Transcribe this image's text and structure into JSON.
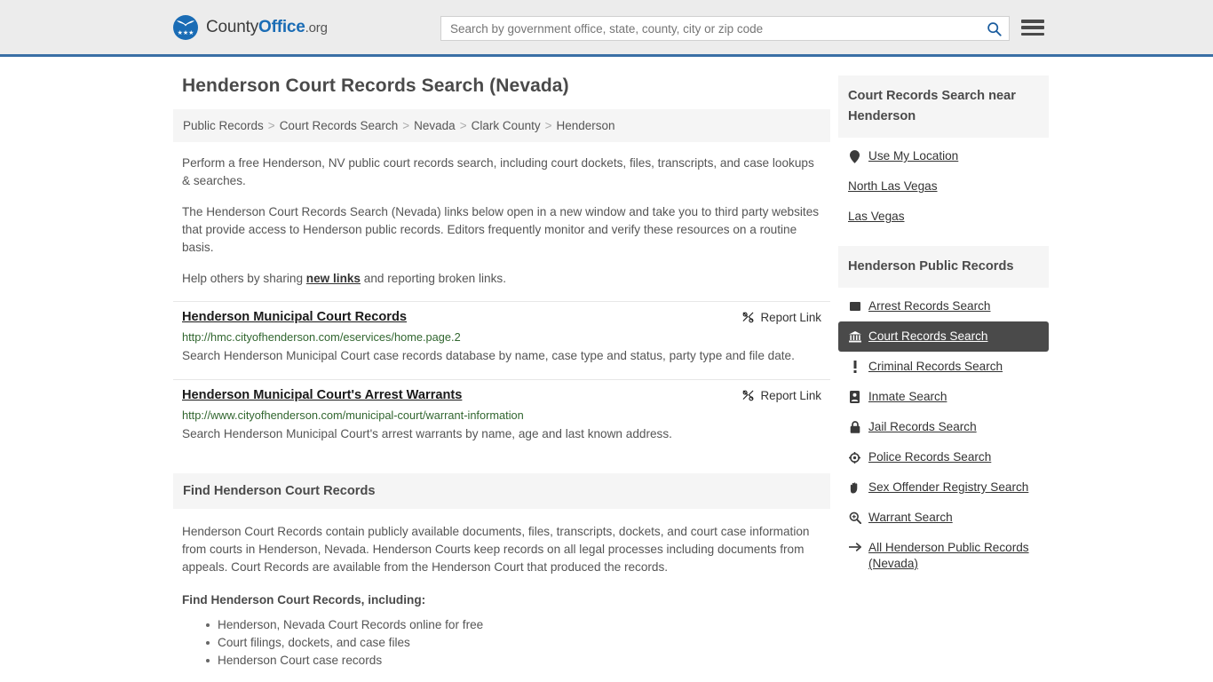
{
  "header": {
    "brand": {
      "part1": "County",
      "part2": "Office",
      "part3": ".org",
      "logo_icon": "eagle-shield-icon"
    },
    "search": {
      "placeholder": "Search by government office, state, county, city or zip code",
      "value": "",
      "icon": "search-icon"
    },
    "menu_icon": "hamburger-menu-icon",
    "accent_color": "#3a6fa5"
  },
  "main": {
    "page_title": "Henderson Court Records Search (Nevada)",
    "breadcrumb": [
      "Public Records",
      "Court Records Search",
      "Nevada",
      "Clark County",
      "Henderson"
    ],
    "breadcrumb_separator": ">",
    "intro_paragraph": "Perform a free Henderson, NV public court records search, including court dockets, files, transcripts, and case lookups & searches.",
    "second_paragraph": "The Henderson Court Records Search (Nevada) links below open in a new window and take you to third party websites that provide access to Henderson public records. Editors frequently monitor and verify these resources on a routine basis.",
    "help_prefix": "Help others by sharing ",
    "help_link": "new links",
    "help_suffix": " and reporting broken links.",
    "results": [
      {
        "title": "Henderson Municipal Court Records",
        "url": "http://hmc.cityofhenderson.com/eservices/home.page.2",
        "description": "Search Henderson Municipal Court case records database by name, case type and status, party type and file date.",
        "report_label": "Report Link",
        "report_icon": "broken-link-icon"
      },
      {
        "title": "Henderson Municipal Court's Arrest Warrants",
        "url": "http://www.cityofhenderson.com/municipal-court/warrant-information",
        "description": "Search Henderson Municipal Court's arrest warrants by name, age and last known address.",
        "report_label": "Report Link",
        "report_icon": "broken-link-icon"
      }
    ],
    "find_section": {
      "heading": "Find Henderson Court Records",
      "paragraph": "Henderson Court Records contain publicly available documents, files, transcripts, dockets, and court case information from courts in Henderson, Nevada. Henderson Courts keep records on all legal processes including documents from appeals. Court Records are available from the Henderson Court that produced the records.",
      "list_heading": "Find Henderson Court Records, including:",
      "list_items": [
        "Henderson, Nevada Court Records online for free",
        "Court filings, dockets, and case files",
        "Henderson Court case records"
      ]
    }
  },
  "sidebar": {
    "near_widget": {
      "heading": "Court Records Search near Henderson",
      "items": [
        {
          "label": "Use My Location",
          "icon": "map-pin-icon",
          "has_icon": true
        },
        {
          "label": "North Las Vegas",
          "icon": "",
          "has_icon": false
        },
        {
          "label": "Las Vegas",
          "icon": "",
          "has_icon": false
        }
      ]
    },
    "records_widget": {
      "heading": "Henderson Public Records",
      "items": [
        {
          "label": "Arrest Records Search",
          "icon": "square-badge-icon",
          "active": false
        },
        {
          "label": "Court Records Search",
          "icon": "courthouse-icon",
          "active": true
        },
        {
          "label": "Criminal Records Search",
          "icon": "exclamation-icon",
          "active": false
        },
        {
          "label": "Inmate Search",
          "icon": "id-card-icon",
          "active": false
        },
        {
          "label": "Jail Records Search",
          "icon": "lock-icon",
          "active": false
        },
        {
          "label": "Police Records Search",
          "icon": "police-badge-icon",
          "active": false
        },
        {
          "label": "Sex Offender Registry Search",
          "icon": "hand-icon",
          "active": false
        },
        {
          "label": "Warrant Search",
          "icon": "magnifier-plus-icon",
          "active": false
        },
        {
          "label": "All Henderson Public Records (Nevada)",
          "icon": "arrow-right-icon",
          "active": false
        }
      ],
      "active_bg": "#4a4a4a"
    }
  }
}
